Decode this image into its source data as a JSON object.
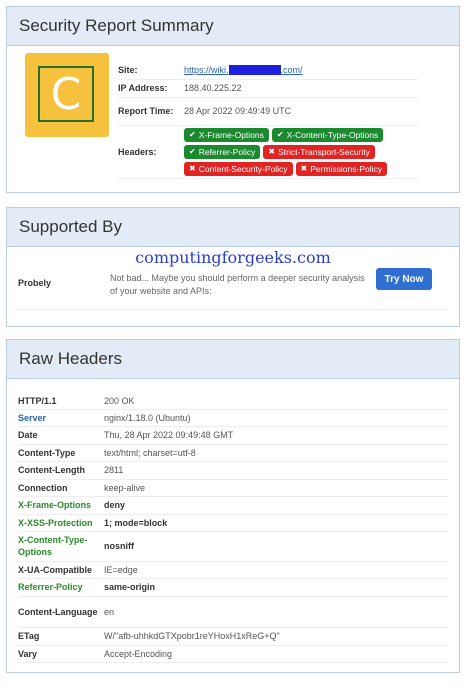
{
  "summary": {
    "title": "Security Report Summary",
    "grade": "C",
    "site_label": "Site:",
    "site_prefix": "https://wiki.",
    "site_suffix": ".com/",
    "ip_label": "IP Address:",
    "ip_value": "188.40.225.22",
    "time_label": "Report Time:",
    "time_value": "28 Apr 2022 09:49:49 UTC",
    "headers_label": "Headers:",
    "badges": [
      {
        "text": "X-Frame-Options",
        "status": "ok"
      },
      {
        "text": "X-Content-Type-Options",
        "status": "ok"
      },
      {
        "text": "Referrer-Policy",
        "status": "ok"
      },
      {
        "text": "Strict-Transport-Security",
        "status": "missing"
      },
      {
        "text": "Content-Security-Policy",
        "status": "missing"
      },
      {
        "text": "Permissions-Policy",
        "status": "missing"
      }
    ],
    "colors": {
      "ok": "#1b8a2e",
      "missing": "#e02424",
      "grade_bg": "#f6c23e"
    }
  },
  "supported": {
    "title": "Supported By",
    "watermark": "computingforgeeks.com",
    "sponsor": "Probely",
    "text": "Not bad... Maybe you should perform a deeper security analysis of your website and APIs:",
    "button": "Try Now"
  },
  "raw": {
    "title": "Raw Headers",
    "rows": [
      {
        "name": "HTTP/1.1",
        "value": "200 OK",
        "nstyle": "",
        "vstyle": ""
      },
      {
        "name": "Server",
        "value": "nginx/1.18.0 (Ubuntu)",
        "nstyle": "blue",
        "vstyle": ""
      },
      {
        "name": "Date",
        "value": "Thu, 28 Apr 2022 09:49:48 GMT",
        "nstyle": "",
        "vstyle": ""
      },
      {
        "name": "Content-Type",
        "value": "text/html; charset=utf-8",
        "nstyle": "",
        "vstyle": ""
      },
      {
        "name": "Content-Length",
        "value": "2811",
        "nstyle": "",
        "vstyle": ""
      },
      {
        "name": "Connection",
        "value": "keep-alive",
        "nstyle": "",
        "vstyle": ""
      },
      {
        "name": "X-Frame-Options",
        "value": "deny",
        "nstyle": "green",
        "vstyle": "bold"
      },
      {
        "name": "X-XSS-Protection",
        "value": "1; mode=block",
        "nstyle": "green",
        "vstyle": "bold"
      },
      {
        "name": "X-Content-Type-Options",
        "value": "nosniff",
        "nstyle": "green",
        "vstyle": "bold"
      },
      {
        "name": "X-UA-Compatible",
        "value": "IE=edge",
        "nstyle": "",
        "vstyle": ""
      },
      {
        "name": "Referrer-Policy",
        "value": "same-origin",
        "nstyle": "green",
        "vstyle": "bold"
      },
      {
        "name": "Content-Language",
        "value": "en",
        "nstyle": "",
        "vstyle": ""
      },
      {
        "name": "ETag",
        "value": "W/\"afb-uhhkdGTXpobr1reYHoxH1xReG+Q\"",
        "nstyle": "",
        "vstyle": ""
      },
      {
        "name": "Vary",
        "value": "Accept-Encoding",
        "nstyle": "",
        "vstyle": ""
      }
    ]
  }
}
